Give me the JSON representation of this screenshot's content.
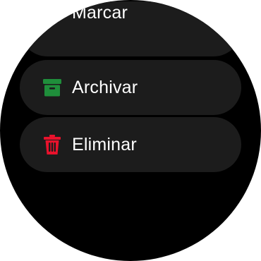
{
  "menu": {
    "items": [
      {
        "label": "Marcar",
        "icon": "flag-icon",
        "icon_color": "#e8122c"
      },
      {
        "label": "Archivar",
        "icon": "archive-icon",
        "icon_color": "#1f8e3b"
      },
      {
        "label": "Eliminar",
        "icon": "trash-icon",
        "icon_color": "#e8122c"
      }
    ]
  },
  "colors": {
    "background": "#000000",
    "chip": "#1c1c1c",
    "text": "#ffffff"
  }
}
